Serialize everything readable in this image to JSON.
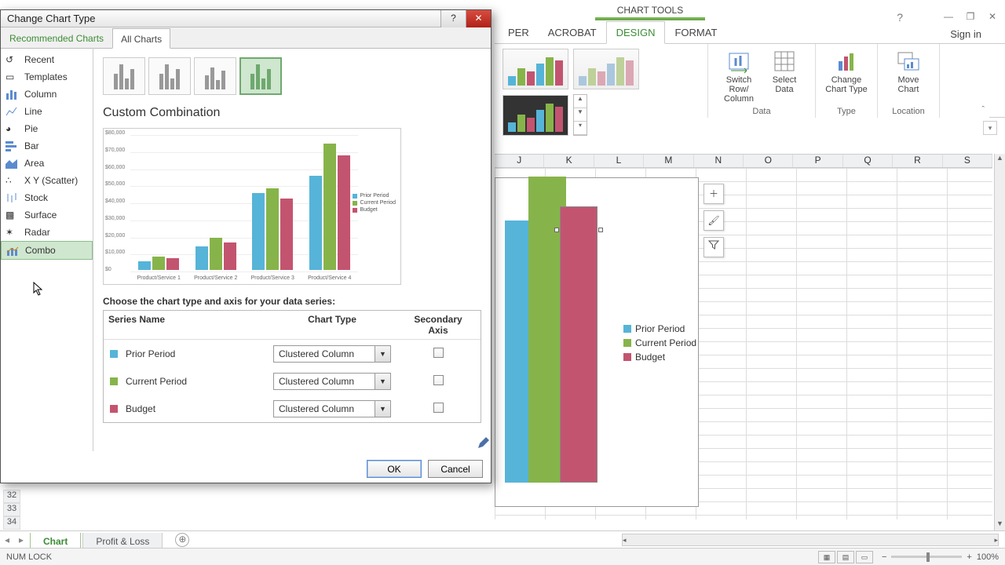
{
  "colors": {
    "prior": "#56B4D8",
    "current": "#87B44A",
    "budget": "#C35470",
    "accent": "#3b8c33"
  },
  "window": {
    "chart_tools": "CHART TOOLS",
    "sign_in": "Sign in"
  },
  "ribbon": {
    "tabs": [
      "PER",
      "ACROBAT",
      "DESIGN",
      "FORMAT"
    ],
    "active_tab": 2,
    "groups": {
      "data": {
        "label": "Data",
        "btn1": "Switch Row/\nColumn",
        "btn2": "Select\nData"
      },
      "type": {
        "label": "Type",
        "btn": "Change\nChart Type"
      },
      "location": {
        "label": "Location",
        "btn": "Move\nChart"
      }
    }
  },
  "columns": [
    "J",
    "K",
    "L",
    "M",
    "N",
    "O",
    "P",
    "Q",
    "R",
    "S"
  ],
  "rows_visible": [
    "32",
    "33",
    "34"
  ],
  "chart_data": {
    "type": "bar",
    "title": "",
    "xlabel": "",
    "ylabel": "",
    "ylim": [
      0,
      80000
    ],
    "yticks": [
      0,
      10000,
      20000,
      30000,
      40000,
      50000,
      60000,
      70000,
      80000
    ],
    "categories": [
      "Product/Service 1",
      "Product/Service 2",
      "Product/Service 3",
      "Product/Service 4"
    ],
    "series": [
      {
        "name": "Prior Period",
        "color": "#56B4D8",
        "values": [
          5000,
          14000,
          45000,
          55000
        ]
      },
      {
        "name": "Current Period",
        "color": "#87B44A",
        "values": [
          8000,
          19000,
          48000,
          74000
        ]
      },
      {
        "name": "Budget",
        "color": "#C35470",
        "values": [
          7000,
          16000,
          42000,
          67000
        ]
      }
    ]
  },
  "embedded_legend": [
    "Prior Period",
    "Current Period",
    "Budget"
  ],
  "sheet_tabs": {
    "active": "Chart",
    "other": "Profit & Loss"
  },
  "status": {
    "numlock": "NUM LOCK",
    "zoom": "100%"
  },
  "dialog": {
    "title": "Change Chart Type",
    "tabs": {
      "recommended": "Recommended Charts",
      "all": "All Charts"
    },
    "categories": [
      "Recent",
      "Templates",
      "Column",
      "Line",
      "Pie",
      "Bar",
      "Area",
      "X Y (Scatter)",
      "Stock",
      "Surface",
      "Radar",
      "Combo"
    ],
    "selected_category": 11,
    "pane_title": "Custom Combination",
    "instruction": "Choose the chart type and axis for your data series:",
    "headers": {
      "name": "Series Name",
      "type": "Chart Type",
      "axis": "Secondary Axis"
    },
    "series_rows": [
      {
        "swatch": "#56B4D8",
        "name": "Prior Period",
        "type": "Clustered Column",
        "secondary": false
      },
      {
        "swatch": "#87B44A",
        "name": "Current Period",
        "type": "Clustered Column",
        "secondary": false
      },
      {
        "swatch": "#C35470",
        "name": "Budget",
        "type": "Clustered Column",
        "secondary": false
      }
    ],
    "ok": "OK",
    "cancel": "Cancel"
  }
}
